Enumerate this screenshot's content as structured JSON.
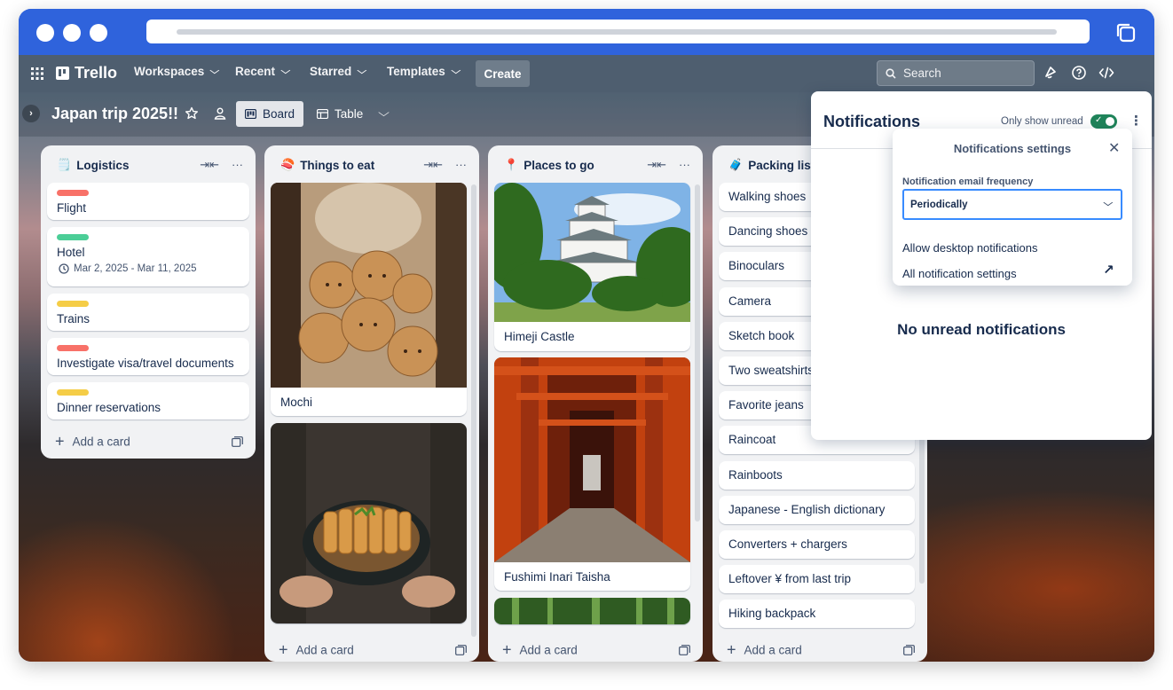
{
  "nav": {
    "logo": "Trello",
    "workspaces": "Workspaces",
    "recent": "Recent",
    "starred": "Starred",
    "templates": "Templates",
    "create": "Create",
    "search_placeholder": "Search"
  },
  "board": {
    "title": "Japan trip 2025!!",
    "view_board": "Board",
    "view_table": "Table"
  },
  "lists": [
    {
      "emoji": "🗒️",
      "title": "Logistics",
      "cards": [
        {
          "text": "Flight",
          "label_color": "#f87168"
        },
        {
          "text": "Hotel",
          "label_color": "#4bce97",
          "date": "Mar 2, 2025 - Mar 11, 2025"
        },
        {
          "text": "Trains",
          "label_color": "#f5cd47"
        },
        {
          "text": "Investigate visa/travel documents",
          "label_color": "#f87168"
        },
        {
          "text": "Dinner reservations",
          "label_color": "#f5cd47"
        }
      ],
      "add_card": "Add a card"
    },
    {
      "emoji": "🍣",
      "title": "Things to eat",
      "cards": [
        {
          "text": "Mochi"
        },
        {
          "text": ""
        }
      ],
      "add_card": "Add a card"
    },
    {
      "emoji": "📍",
      "title": "Places to go",
      "cards": [
        {
          "text": "Himeji Castle"
        },
        {
          "text": "Fushimi Inari Taisha"
        }
      ],
      "add_card": "Add a card"
    },
    {
      "emoji": "🧳",
      "title": "Packing list",
      "cards": [
        {
          "text": "Walking shoes"
        },
        {
          "text": "Dancing shoes"
        },
        {
          "text": "Binoculars"
        },
        {
          "text": "Camera"
        },
        {
          "text": "Sketch book"
        },
        {
          "text": "Two sweatshirts"
        },
        {
          "text": "Favorite jeans"
        },
        {
          "text": "Raincoat"
        },
        {
          "text": "Rainboots"
        },
        {
          "text": "Japanese - English dictionary"
        },
        {
          "text": "Converters + chargers"
        },
        {
          "text": "Leftover ¥ from last trip"
        },
        {
          "text": "Hiking backpack"
        }
      ],
      "add_card": "Add a card"
    }
  ],
  "notifications": {
    "title": "Notifications",
    "only_show_unread": "Only show unread",
    "toggle_on": true,
    "empty_message": "No unread notifications",
    "settings": {
      "title": "Notifications settings",
      "email_frequency_label": "Notification email frequency",
      "email_frequency_value": "Periodically",
      "allow_desktop": "Allow desktop notifications",
      "all_settings": "All notification settings"
    }
  },
  "colors": {
    "browser_blue": "#2f63dc",
    "nav_bg": "#4e5e6f",
    "toggle_green": "#1f845a",
    "focus_blue": "#388bff"
  }
}
